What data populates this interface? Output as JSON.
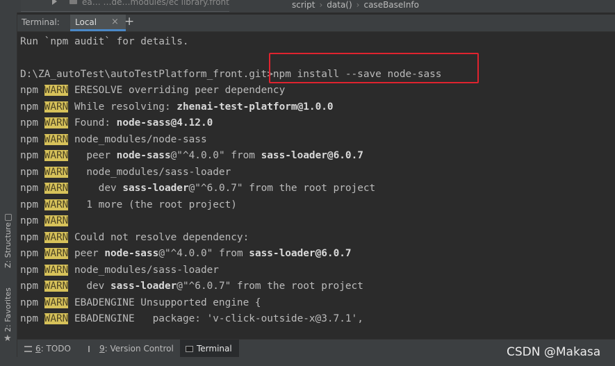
{
  "top": {
    "file": "ea… …de…modules/ec library.front",
    "breadcrumb": [
      "script",
      "data()",
      "caseBaseInfo"
    ]
  },
  "sidebar": {
    "structure_label": "Z: Structure",
    "favorites_label": "2: Favorites"
  },
  "terminal_tabs": {
    "label": "Terminal:",
    "active_tab": "Local",
    "close_glyph": "×",
    "add_glyph": "+"
  },
  "terminal": {
    "warn_tag": "WARN",
    "npm_tag": "npm",
    "lines": [
      "Run `npm audit` for details.",
      "",
      "D:\\ZA_autoTest\\autoTestPlatform_front.git>npm install --save node-sass"
    ],
    "warn_lines": [
      {
        "pre": "ERESOLVE overriding peer dependency"
      },
      {
        "pre": "While resolving: ",
        "bold": "zhenai-test-platform@1.0.0"
      },
      {
        "pre": "Found: ",
        "bold": "node-sass@4.12.0"
      },
      {
        "pre": "node_modules/node-sass"
      },
      {
        "pre": "  peer ",
        "bold": "node-sass",
        "mid": "@\"^4.0.0\" from ",
        "bold2": "sass-loader@6.0.7"
      },
      {
        "pre": "  node_modules/sass-loader"
      },
      {
        "pre": "    dev ",
        "bold": "sass-loader",
        "mid": "@\"^6.0.7\" from the root project"
      },
      {
        "pre": "  1 more (the root project)"
      },
      {
        "pre": ""
      },
      {
        "pre": "Could not resolve dependency:"
      },
      {
        "pre": "peer ",
        "bold": "node-sass",
        "mid": "@\"^4.0.0\" from ",
        "bold2": "sass-loader@6.0.7"
      },
      {
        "pre": "node_modules/sass-loader"
      },
      {
        "pre": "  dev ",
        "bold": "sass-loader",
        "mid": "@\"^6.0.7\" from the root project"
      },
      {
        "pre": "EBADENGINE Unsupported engine {"
      },
      {
        "pre": "EBADENGINE   package: 'v-click-outside-x@3.7.1',"
      }
    ]
  },
  "bottom_tabs": {
    "todo_num": "6",
    "todo": ": TODO",
    "vc_num": "9",
    "vc": ": Version Control",
    "terminal": "Terminal"
  },
  "watermark": "CSDN @Makasa"
}
